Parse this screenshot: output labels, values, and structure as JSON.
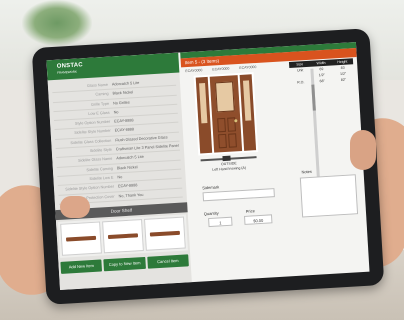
{
  "app": {
    "logo_text": "ONSTAC",
    "logo_sub": "FRAMEWORK"
  },
  "properties": [
    {
      "name": "Glass Name",
      "value": "Adorcatch 5 Lite"
    },
    {
      "name": "Caming",
      "value": "Black Nickel"
    },
    {
      "name": "Grille Type",
      "value": "No Grilles"
    },
    {
      "name": "Low E Glass",
      "value": "No"
    },
    {
      "name": "Style Option Number",
      "value": "ECAY-8888"
    },
    {
      "name": "Sidelite Style Number",
      "value": "ECAY-8888"
    },
    {
      "name": "Sidelite Glass Collection",
      "value": "Flush Glazed Decorative Glass"
    },
    {
      "name": "Sidelite Style",
      "value": "Craftsman Lite 3 Panel Sidelite Panel"
    },
    {
      "name": "Sidelite Glass Name",
      "value": "Adorcatch 5 Lite"
    },
    {
      "name": "Sidelite Caming",
      "value": "Black Nickel"
    },
    {
      "name": "Sidelite Low E",
      "value": "No"
    },
    {
      "name": "Sidelite Style Option Number",
      "value": "ECAY-8888"
    },
    {
      "name": "Door Protection Cover",
      "value": "No, Thank You"
    }
  ],
  "shelf": {
    "title": "Door Shelf"
  },
  "buttons": {
    "add_new": "Add New Item",
    "copy_new": "Copy to New Item",
    "cancel": "Cancel Item"
  },
  "item": {
    "header": "Item 5 - (3 Items)",
    "col_left": "ECAY0000",
    "col_mid": "ECAY0000",
    "col_right": "ECAY0000"
  },
  "size_table": {
    "headers": [
      "Size",
      "Width",
      "Height"
    ],
    "rows": [
      [
        "Unit",
        "69",
        "83"
      ],
      [
        "",
        "1/2\"",
        "1/2\""
      ],
      [
        "R.O.",
        "68\"",
        "82\""
      ]
    ]
  },
  "door": {
    "caption_line1": "OUTSIDE",
    "caption_line2": "Left Hand Inswing (A)"
  },
  "fields": {
    "sidemark_label": "Sidemark",
    "notes_label": "Notes",
    "quantity_label": "Quantity",
    "quantity_value": "1",
    "price_label": "Price",
    "price_value": "$0.00"
  },
  "colors": {
    "brand_green": "#2d7a3a",
    "accent_orange": "#d9531e",
    "door_wood": "#8f4e2c"
  }
}
